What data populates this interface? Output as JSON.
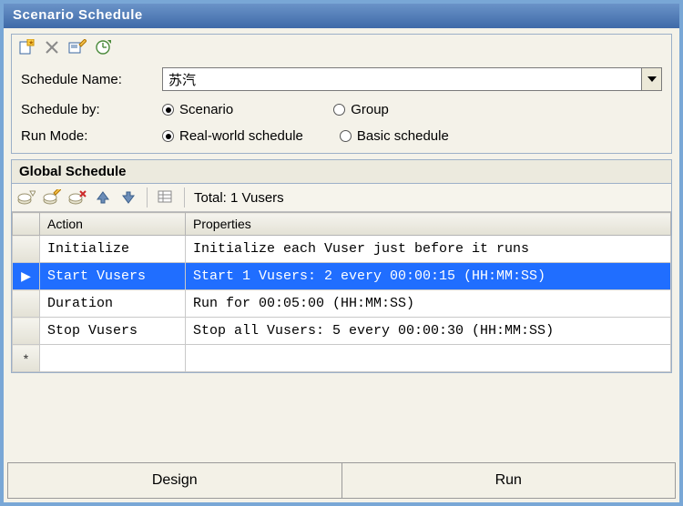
{
  "window": {
    "title": "Scenario Schedule"
  },
  "form": {
    "schedule_name_label": "Schedule Name:",
    "schedule_name_value": "苏汽",
    "schedule_by_label": "Schedule by:",
    "schedule_by_options": {
      "scenario": "Scenario",
      "group": "Group"
    },
    "schedule_by_selected": "scenario",
    "run_mode_label": "Run Mode:",
    "run_mode_options": {
      "real": "Real-world schedule",
      "basic": "Basic schedule"
    },
    "run_mode_selected": "real"
  },
  "global_schedule": {
    "title": "Global Schedule",
    "totals": "Total: 1 Vusers",
    "columns": {
      "action": "Action",
      "properties": "Properties"
    },
    "add_row_marker": "*",
    "rows": [
      {
        "action": "Initialize",
        "properties": "Initialize each Vuser just before it runs",
        "selected": false
      },
      {
        "action": "Start  Vusers",
        "properties": "Start 1 Vusers: 2 every 00:00:15 (HH:MM:SS)",
        "selected": true
      },
      {
        "action": "Duration",
        "properties": "Run for 00:05:00 (HH:MM:SS)",
        "selected": false
      },
      {
        "action": "Stop Vusers",
        "properties": "Stop all Vusers: 5 every 00:00:30 (HH:MM:SS)",
        "selected": false
      }
    ]
  },
  "tabs": {
    "design": "Design",
    "run": "Run"
  }
}
